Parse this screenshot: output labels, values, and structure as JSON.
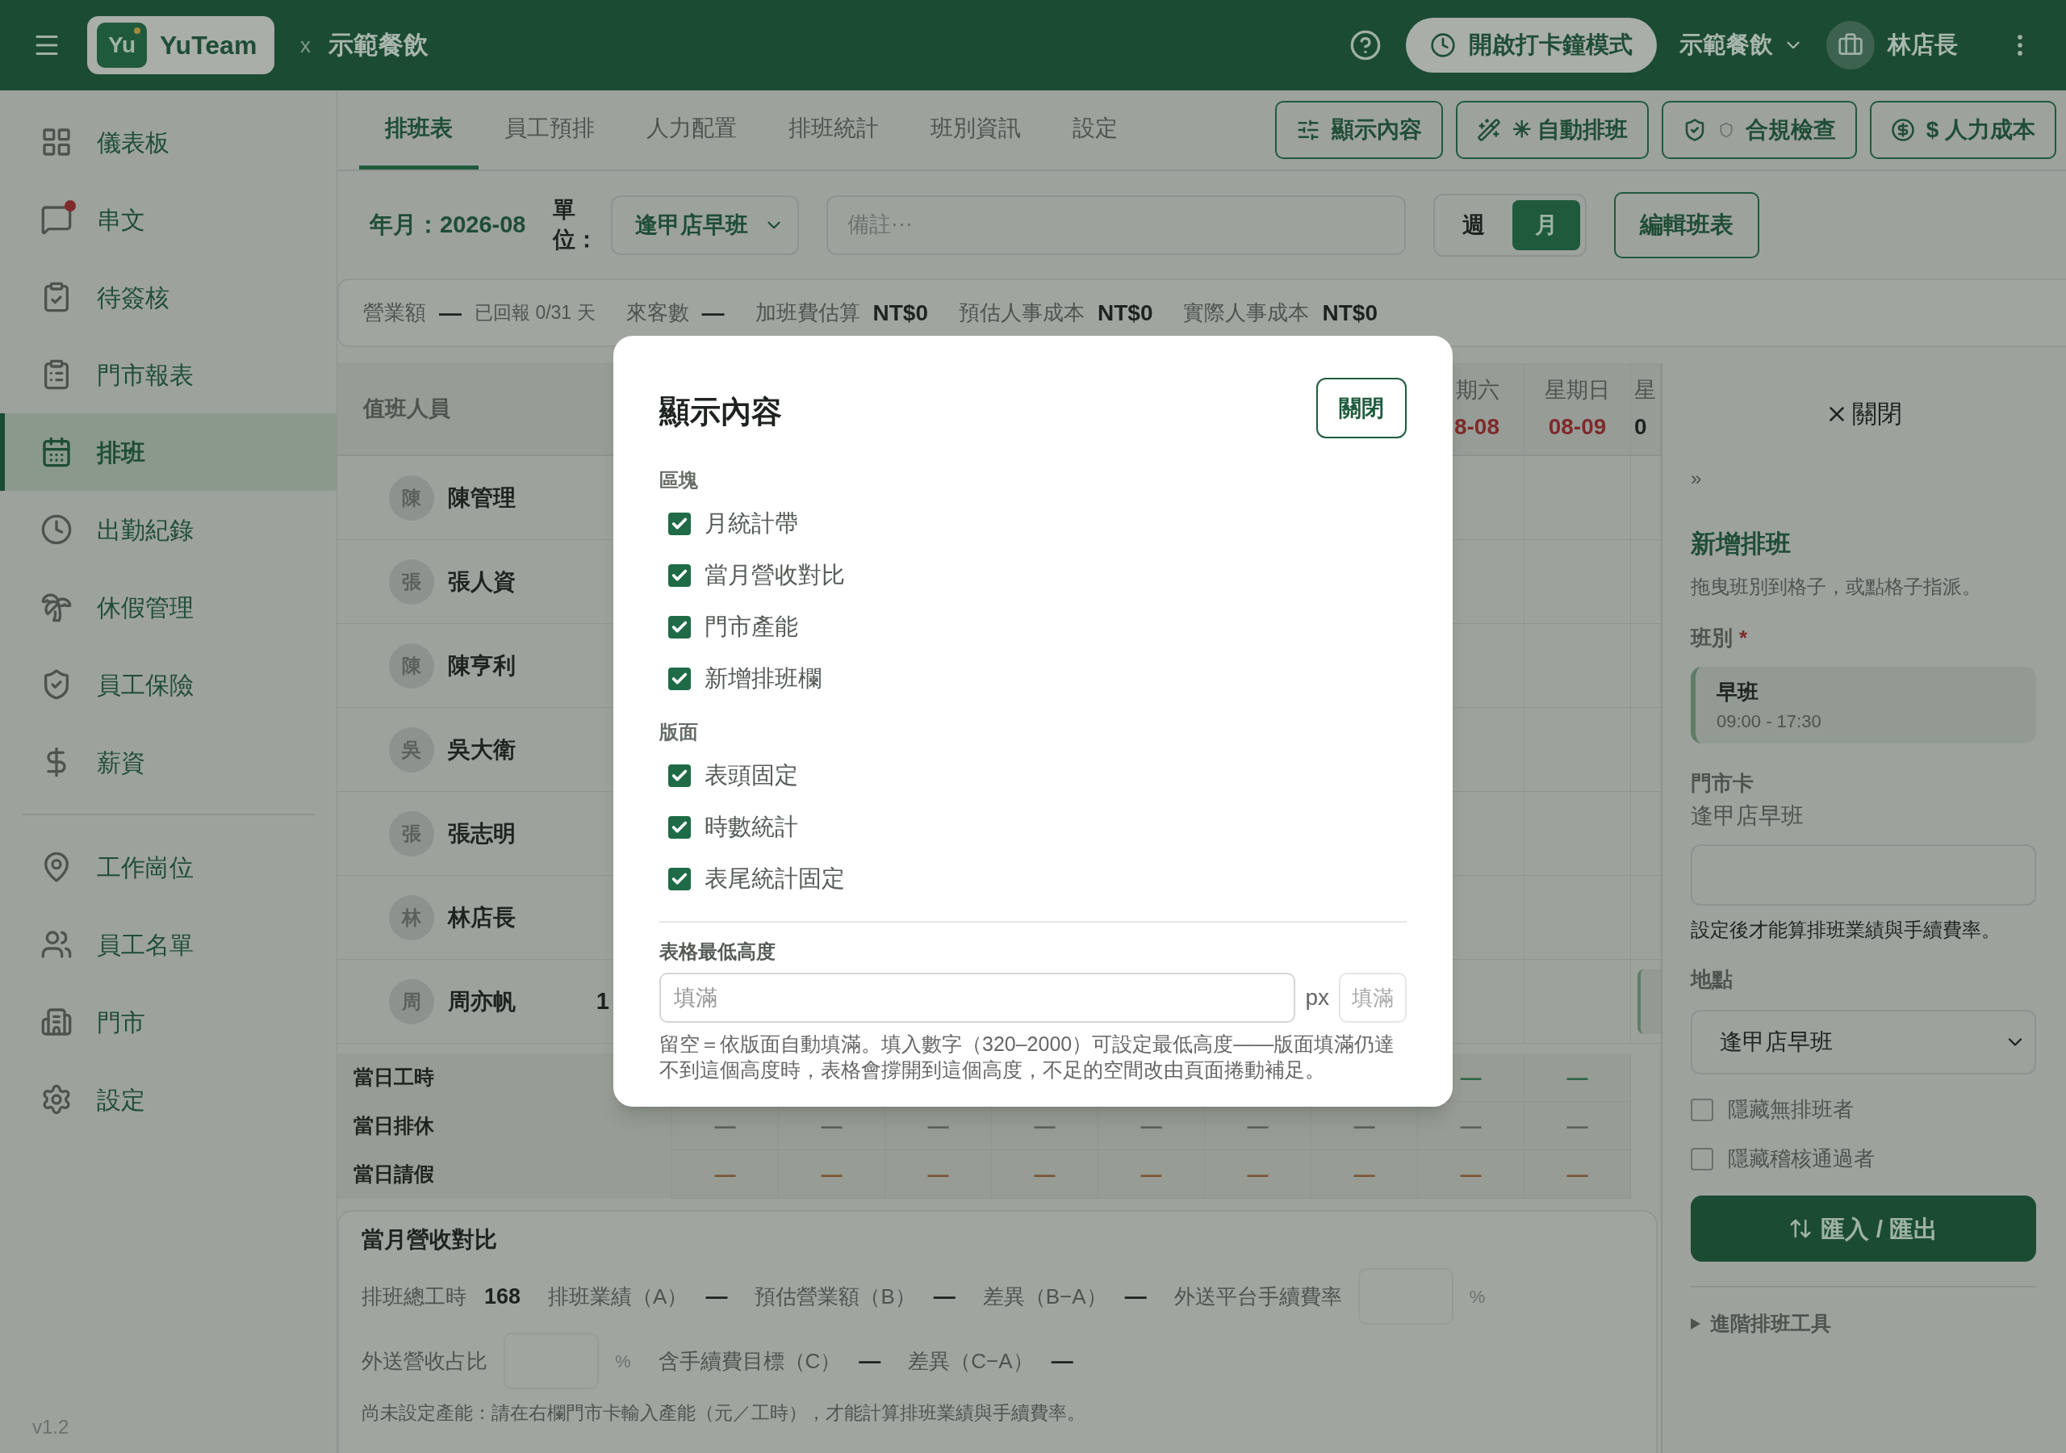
{
  "top_bar": {
    "logo_text": "Yu",
    "brand": "YuTeam",
    "separator": "x",
    "org": "示範餐飲",
    "clock_button": "開啟打卡鐘模式",
    "org_switcher": "示範餐飲",
    "user": "林店長"
  },
  "sidebar": {
    "groups": [
      [
        {
          "label": "儀表板",
          "selected": false,
          "badge": false
        },
        {
          "label": "串文",
          "selected": false,
          "badge": true
        },
        {
          "label": "待簽核",
          "selected": false,
          "badge": false
        },
        {
          "label": "門市報表",
          "selected": false,
          "badge": false
        },
        {
          "label": "排班",
          "selected": true,
          "badge": false
        },
        {
          "label": "出勤紀錄",
          "selected": false,
          "badge": false
        },
        {
          "label": "休假管理",
          "selected": false,
          "badge": false
        },
        {
          "label": "員工保險",
          "selected": false,
          "badge": false
        },
        {
          "label": "薪資",
          "selected": false,
          "badge": false
        }
      ],
      [
        {
          "label": "工作崗位",
          "selected": false,
          "badge": false
        },
        {
          "label": "員工名單",
          "selected": false,
          "badge": false
        },
        {
          "label": "門市",
          "selected": false,
          "badge": false
        },
        {
          "label": "設定",
          "selected": false,
          "badge": false
        }
      ]
    ],
    "version": "v1.2"
  },
  "tabs": [
    {
      "label": "排班表",
      "selected": true
    },
    {
      "label": "員工預排",
      "selected": false
    },
    {
      "label": "人力配置",
      "selected": false
    },
    {
      "label": "排班統計",
      "selected": false
    },
    {
      "label": "班別資訊",
      "selected": false
    },
    {
      "label": "設定",
      "selected": false
    }
  ],
  "actions": [
    {
      "kind": "display",
      "label": "顯示內容"
    },
    {
      "kind": "auto",
      "label": "✳ 自動排班"
    },
    {
      "kind": "compliance",
      "label": "合規檢查"
    },
    {
      "kind": "cost",
      "label": "$ 人力成本"
    }
  ],
  "toolbar": {
    "period": "年月：2026-08",
    "unit_label": "單位：",
    "unit_select": "逢甲店早班",
    "notes_placeholder": "備註⋯",
    "view_modes": [
      {
        "label": "週",
        "selected": false
      },
      {
        "label": "月",
        "selected": true
      }
    ],
    "edit_button": "編輯班表"
  },
  "stats": [
    {
      "label": "營業額",
      "value": "—",
      "note": "已回報 0/31 天"
    },
    {
      "label": "來客數",
      "value": "—"
    },
    {
      "label": "加班費估算",
      "value": "NT$0"
    },
    {
      "label": "預估人事成本",
      "value": "NT$0"
    },
    {
      "label": "實際人事成本",
      "value": "NT$0"
    }
  ],
  "schedule": {
    "header_label": "值班人員",
    "day_headers": [
      {
        "weekday": "期六",
        "date": "8-08",
        "weekend": true
      },
      {
        "weekday": "星期日",
        "date": "08-09",
        "weekend": true
      },
      {
        "weekday": "星",
        "date": "0",
        "weekend": false
      }
    ],
    "staff": [
      {
        "avatar": "陳",
        "name": "陳管理",
        "has_shift": false
      },
      {
        "avatar": "張",
        "name": "張人資",
        "has_shift": false
      },
      {
        "avatar": "陳",
        "name": "陳亨利",
        "has_shift": false
      },
      {
        "avatar": "吳",
        "name": "吳大衛",
        "has_shift": false
      },
      {
        "avatar": "張",
        "name": "張志明",
        "has_shift": false
      },
      {
        "avatar": "林",
        "name": "林店長",
        "has_shift": false
      },
      {
        "avatar": "周",
        "name": "周亦帆",
        "hours": "1",
        "has_shift": true
      }
    ],
    "summary": [
      {
        "label": "當日工時",
        "color": "#2f6446",
        "cells": [
          "—",
          "—"
        ]
      },
      {
        "label": "當日排休",
        "color": "#5b625c",
        "cells": [
          "—",
          "—",
          "—",
          "—",
          "—",
          "—",
          "—",
          "—",
          "—"
        ]
      },
      {
        "label": "當日請假",
        "color": "#7a5434",
        "cells": [
          "—",
          "—",
          "—",
          "—",
          "—",
          "—",
          "—",
          "—",
          "—"
        ]
      }
    ]
  },
  "revenue": {
    "title": "當月營收對比",
    "lines": [
      [
        {
          "kind": "metric",
          "label": "排班總工時",
          "value": "168"
        },
        {
          "kind": "metric",
          "label": "排班業績（A）",
          "value": "—"
        },
        {
          "kind": "metric",
          "label": "預估營業額（B）",
          "value": "—"
        },
        {
          "kind": "metric",
          "label": "差異（B−A）",
          "value": "—"
        },
        {
          "kind": "input",
          "label": "外送平台手續費率",
          "unit": "%"
        }
      ],
      [
        {
          "kind": "input",
          "label": "外送營收占比",
          "unit": "%"
        },
        {
          "kind": "metric",
          "label": "含手續費目標（C）",
          "value": "—"
        },
        {
          "kind": "metric",
          "label": "差異（C−A）",
          "value": "—"
        }
      ]
    ],
    "notice": "尚未設定產能：請在右欄門市卡輸入產能（元／工時），才能計算排班業績與手續費率。"
  },
  "panel": {
    "close": "關閉",
    "collapse": "»",
    "title": "新增排班",
    "hint": "拖曳班別到格子，或點格子指派。",
    "shift_label": "班別",
    "required_mark": "*",
    "shift": {
      "name": "早班",
      "time": "09:00 - 17:30"
    },
    "store_card_label": "門市卡",
    "store_name": "逢甲店早班",
    "store_note": "設定後才能算排班業績與手續費率。",
    "location_label": "地點",
    "location": "逢甲店早班",
    "filters": [
      {
        "label": "隱藏無排班者",
        "checked": false
      },
      {
        "label": "隱藏稽核通過者",
        "checked": false
      }
    ],
    "import_export": "匯入 / 匯出",
    "advanced": "進階排班工具",
    "advanced_expanded": false
  },
  "modal": {
    "title": "顯示內容",
    "close": "關閉",
    "sections": [
      {
        "title": "區塊",
        "options": [
          {
            "label": "月統計帶",
            "checked": true
          },
          {
            "label": "當月營收對比",
            "checked": true
          },
          {
            "label": "門市產能",
            "checked": true
          },
          {
            "label": "新增排班欄",
            "checked": true
          }
        ]
      },
      {
        "title": "版面",
        "options": [
          {
            "label": "表頭固定",
            "checked": true
          },
          {
            "label": "時數統計",
            "checked": true
          },
          {
            "label": "表尾統計固定",
            "checked": true
          }
        ]
      }
    ],
    "min_height": {
      "label": "表格最低高度",
      "placeholder": "填滿",
      "unit": "px",
      "fill_button": "填滿",
      "help": "留空＝依版面自動填滿。填入數字（320–2000）可設定最低高度——版面填滿仍達不到這個高度時，表格會撐開到這個高度，不足的空間改由頁面捲動補足。"
    }
  }
}
